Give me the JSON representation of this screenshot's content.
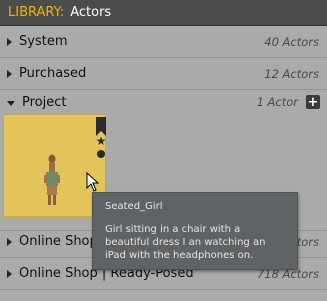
{
  "header": {
    "library_label": "LIBRARY:",
    "title": "Actors"
  },
  "rows": [
    {
      "label": "System",
      "count": "40 Actors"
    },
    {
      "label": "Purchased",
      "count": "12 Actors"
    },
    {
      "label": "Project",
      "count": "1 Actor",
      "add": "+"
    },
    {
      "label": "Online Shop | Posable",
      "count": "584 Actors"
    },
    {
      "label": "Online Shop | Ready-Posed",
      "count": "718 Actors"
    }
  ],
  "tooltip": {
    "title": "Seated_Girl",
    "description": "Girl sitting in a chair with a beautiful dress I an watching an iPad with the headphones on."
  },
  "colors": {
    "accent": "#f3b300",
    "thumbnail_bg": "#e2c45a",
    "header_bg": "#4c4c4c",
    "panel_bg": "#a9abab"
  }
}
